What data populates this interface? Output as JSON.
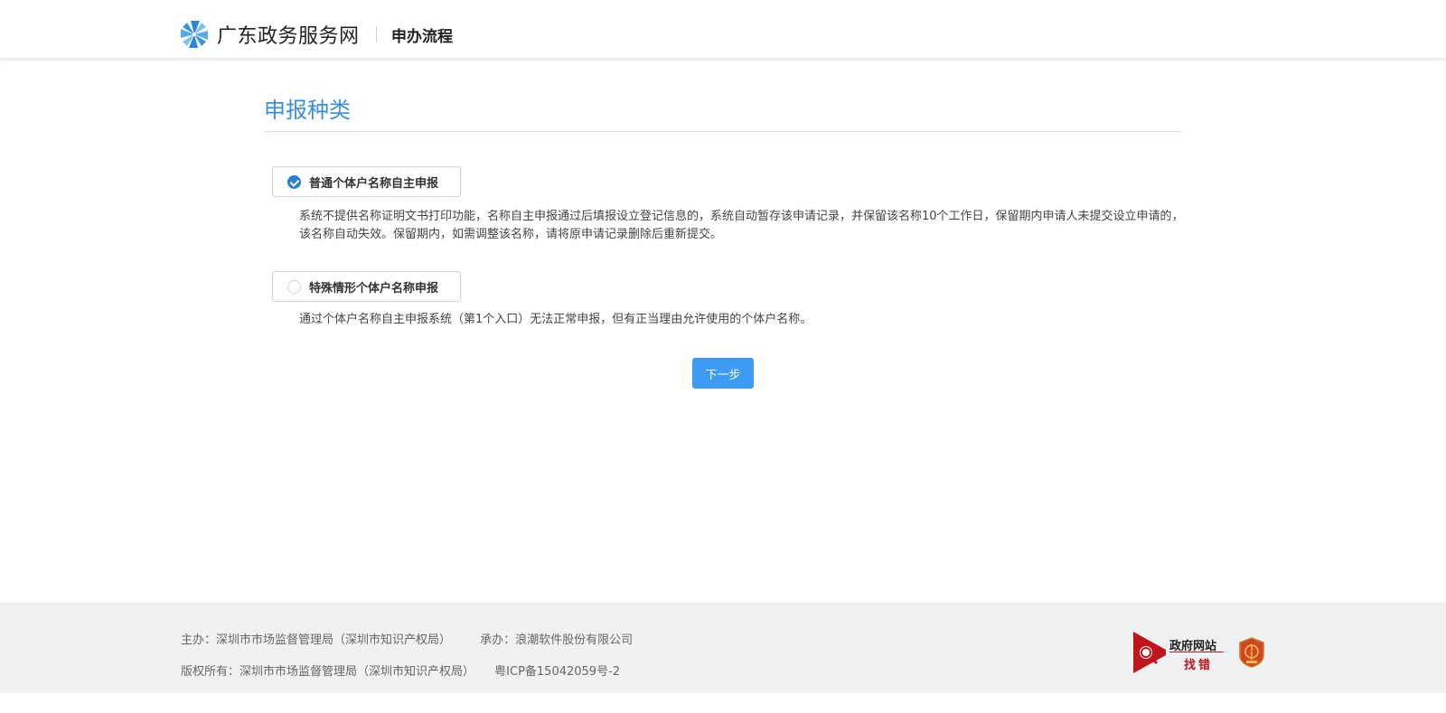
{
  "header": {
    "site_name": "广东政务服务网",
    "page_name": "申办流程"
  },
  "main": {
    "section_title": "申报种类",
    "options": [
      {
        "label": "普通个体户名称自主申报",
        "checked": true,
        "description": "系统不提供名称证明文书打印功能，名称自主申报通过后填报设立登记信息的，系统自动暂存该申请记录，并保留该名称10个工作日，保留期内申请人未提交设立申请的，该名称自动失效。保留期内，如需调整该名称，请将原申请记录删除后重新提交。"
      },
      {
        "label": "特殊情形个体户名称申报",
        "checked": false,
        "description": "通过个体户名称自主申报系统（第1个入口）无法正常申报，但有正当理由允许使用的个体户名称。"
      }
    ],
    "next_button": "下一步"
  },
  "footer": {
    "sponsor": "主办：深圳市市场监督管理局（深圳市知识产权局）",
    "organizer": "承办：浪潮软件股份有限公司",
    "copyright": "版权所有：深圳市市场监督管理局（深圳市知识产权局）",
    "icp": "粤ICP备15042059号-2",
    "badge_title": "政府网站",
    "badge_sub": "找错"
  },
  "colors": {
    "accent": "#3b8fd6",
    "button": "#3d9bf4",
    "badge_red": "#c0161b"
  }
}
